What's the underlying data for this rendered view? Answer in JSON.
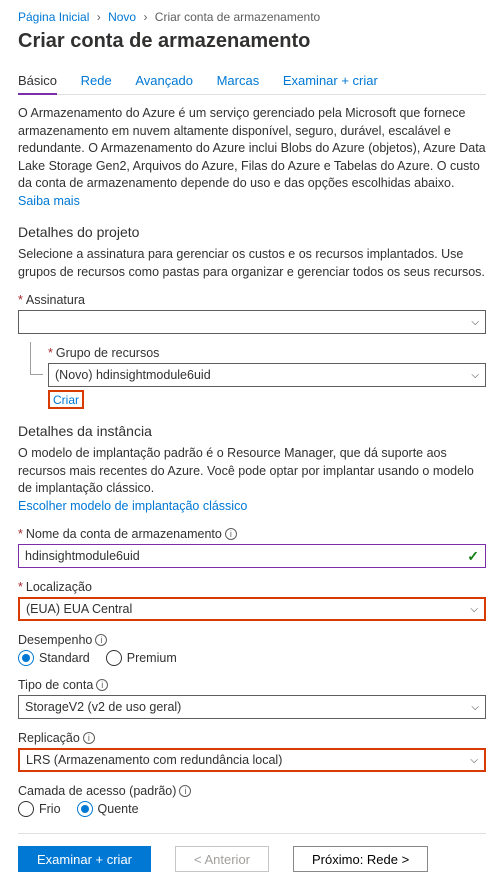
{
  "breadcrumb": {
    "home": "Página Inicial",
    "new": "Novo",
    "current": "Criar conta de armazenamento"
  },
  "title": "Criar conta de armazenamento",
  "tabs": {
    "t0": "Básico",
    "t1": "Rede",
    "t2": "Avançado",
    "t3": "Marcas",
    "t4": "Examinar + criar"
  },
  "intro": "O Armazenamento do Azure é um serviço gerenciado pela Microsoft que fornece armazenamento em nuvem altamente disponível, seguro, durável, escalável e redundante. O Armazenamento do Azure inclui Blobs do Azure (objetos), Azure Data Lake Storage Gen2, Arquivos do Azure, Filas do Azure e Tabelas do Azure. O custo da conta de armazenamento depende do uso e das opções escolhidas abaixo. ",
  "learnMore": "Saiba mais",
  "project": {
    "heading": "Detalhes do projeto",
    "desc": "Selecione a assinatura para gerenciar os custos e os recursos implantados. Use grupos de recursos como pastas para organizar e gerenciar todos os seus recursos.",
    "subLabel": "Assinatura",
    "subValue": "",
    "rgLabel": "Grupo de recursos",
    "rgValue": "(Novo) hdinsightmodule6uid",
    "create": "Criar"
  },
  "instance": {
    "heading": "Detalhes da instância",
    "desc": "O modelo de implantação padrão é o Resource Manager, que dá suporte aos recursos mais recentes do Azure. Você pode optar por implantar usando o modelo de implantação clássico.",
    "classicLink": "Escolher modelo de implantação clássico",
    "nameLabel": "Nome da conta de armazenamento",
    "nameValue": "hdinsightmodule6uid",
    "locLabel": "Localização",
    "locValue": "(EUA) EUA Central",
    "perfLabel": "Desempenho",
    "perf0": "Standard",
    "perf1": "Premium",
    "kindLabel": "Tipo de conta",
    "kindValue": "StorageV2 (v2 de uso geral)",
    "replLabel": "Replicação",
    "replValue": "LRS (Armazenamento com redundância local)",
    "tierLabel": "Camada de acesso (padrão)",
    "tier0": "Frio",
    "tier1": "Quente"
  },
  "footer": {
    "review": "Examinar + criar",
    "prev": "< Anterior",
    "next": "Próximo: Rede >"
  }
}
